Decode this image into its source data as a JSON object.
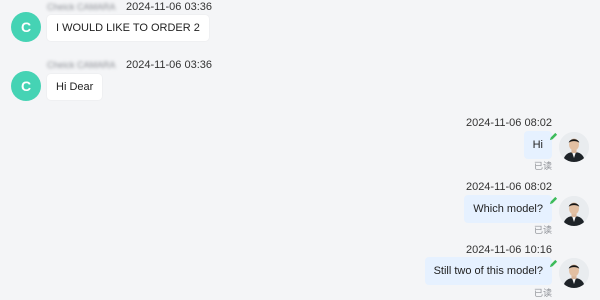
{
  "messages": [
    {
      "direction": "incoming",
      "sender_initial": "C",
      "sender_name": "Cheick CAMARA",
      "time": "2024-11-06 03:36",
      "text": "I WOULD LIKE TO ORDER 2"
    },
    {
      "direction": "incoming",
      "sender_initial": "C",
      "sender_name": "Cheick CAMARA",
      "time": "2024-11-06 03:36",
      "text": "Hi Dear"
    },
    {
      "direction": "outgoing",
      "time": "2024-11-06 08:02",
      "text": "Hi",
      "status": "已读"
    },
    {
      "direction": "outgoing",
      "time": "2024-11-06 08:02",
      "text": "Which model?",
      "status": "已读"
    },
    {
      "direction": "outgoing",
      "time": "2024-11-06 10:16",
      "text": "Still two of this model?",
      "status": "已读"
    }
  ],
  "colors": {
    "page_background": "#f4f5f7",
    "incoming_avatar": "#45d3b4",
    "incoming_bubble": "#ffffff",
    "outgoing_bubble": "#e6f1ff",
    "edit_icon": "#3dbb5a"
  },
  "icons": {
    "outgoing_avatar": "user-photo-avatar",
    "edit_marker": "pencil-icon"
  }
}
